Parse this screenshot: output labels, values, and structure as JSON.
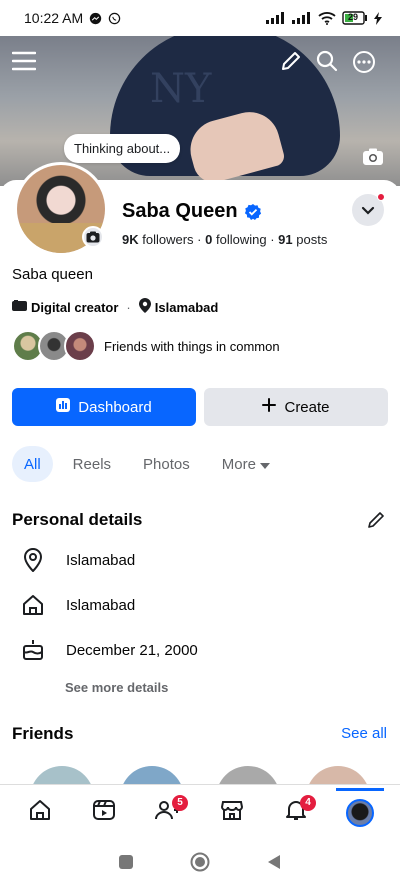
{
  "status_bar": {
    "time": "10:22 AM",
    "battery": "29"
  },
  "profile": {
    "thought_bubble": "Thinking about...",
    "name": "Saba Queen",
    "followers_count": "9K",
    "followers_label": "followers",
    "following_count": "0",
    "following_label": "following",
    "posts_count": "91",
    "posts_label": "posts",
    "bio": "Saba queen",
    "category": "Digital creator",
    "location": "Islamabad",
    "friends_in_common": "Friends with things in common"
  },
  "actions": {
    "dashboard": "Dashboard",
    "create": "Create"
  },
  "tabs": [
    {
      "label": "All",
      "active": true
    },
    {
      "label": "Reels"
    },
    {
      "label": "Photos"
    },
    {
      "label": "More"
    }
  ],
  "personal_details": {
    "title": "Personal details",
    "items": [
      {
        "icon": "location-pin-icon",
        "text": "Islamabad"
      },
      {
        "icon": "home-icon",
        "text": "Islamabad"
      },
      {
        "icon": "birthday-cake-icon",
        "text": "December 21, 2000"
      }
    ],
    "see_more": "See more details"
  },
  "friends": {
    "title": "Friends",
    "see_all": "See all"
  },
  "bottom_nav": {
    "friends_badge": "5",
    "notifications_badge": "4"
  },
  "colors": {
    "accent": "#0866ff",
    "badge": "#e41e3f"
  }
}
